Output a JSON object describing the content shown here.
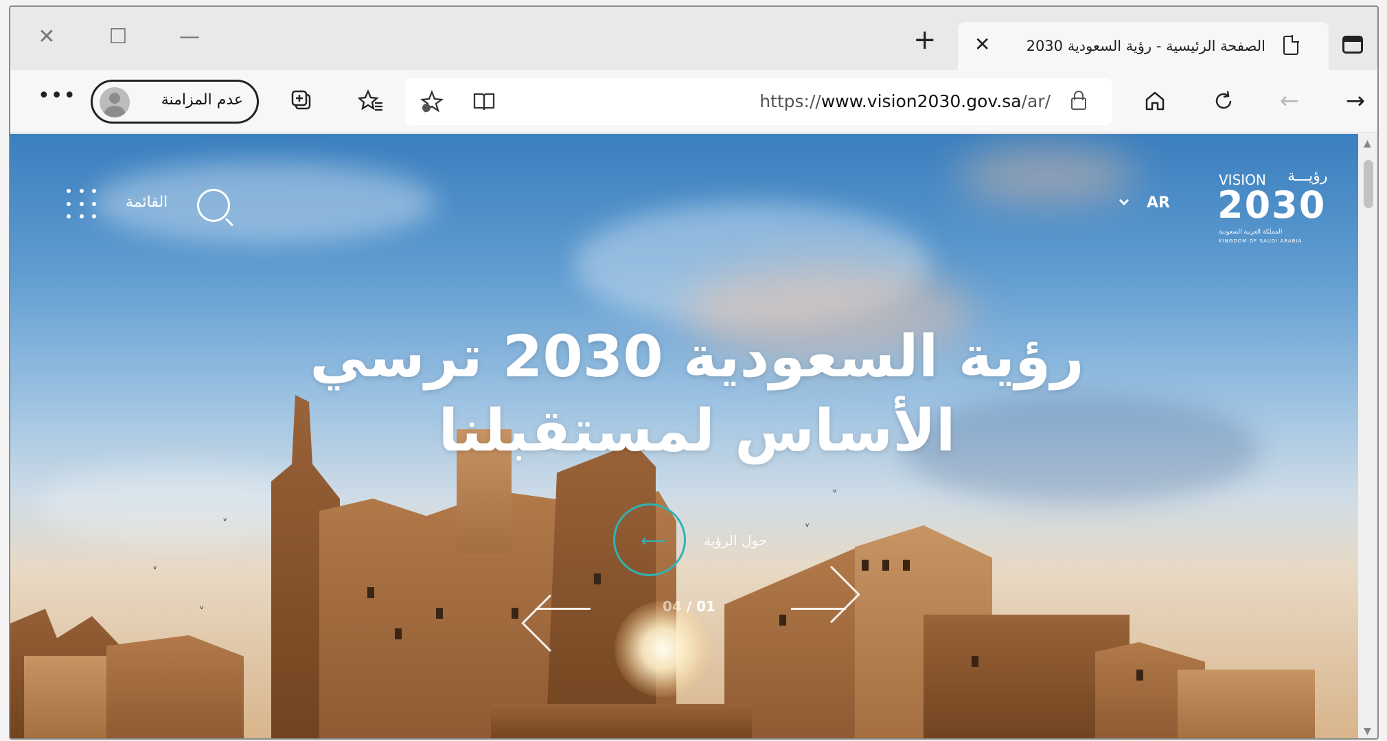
{
  "browser": {
    "tab_title": "الصفحة الرئيسية - رؤية السعودية 2030",
    "url_prefix": "https://",
    "url_host": "www.vision2030.gov.sa",
    "url_path": "/ar/",
    "profile_label": "عدم المزامنة"
  },
  "site": {
    "logo_vision": "VISION",
    "logo_arabic": "رؤيـــة",
    "logo_year": "2030",
    "logo_sub_ar": "المملكة العربية السعودية",
    "logo_sub_en": "KINGDOM OF SAUDI ARABIA",
    "lang": "AR",
    "menu_label": "القائمة"
  },
  "hero": {
    "title_line1": "رؤية السعودية 2030 ترسي",
    "title_line2": "الأساس لمستقبلنا",
    "cta_label": "حول الرؤية",
    "slide_current": "01",
    "slide_total": "04"
  }
}
